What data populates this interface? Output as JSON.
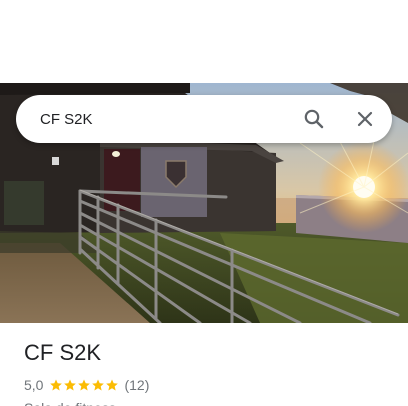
{
  "search": {
    "value": "CF S2K"
  },
  "place": {
    "title": "CF S2K",
    "rating": "5,0",
    "stars": 5,
    "review_count": "(12)",
    "category": "Sala de fitness"
  },
  "photo": {
    "subject": "building-at-sunset"
  },
  "colors": {
    "star": "#FBBC04",
    "secondary_text": "#70757a",
    "primary_text": "#202124"
  },
  "icons": {
    "search": "search-icon",
    "close": "close-icon",
    "star": "star-icon"
  }
}
